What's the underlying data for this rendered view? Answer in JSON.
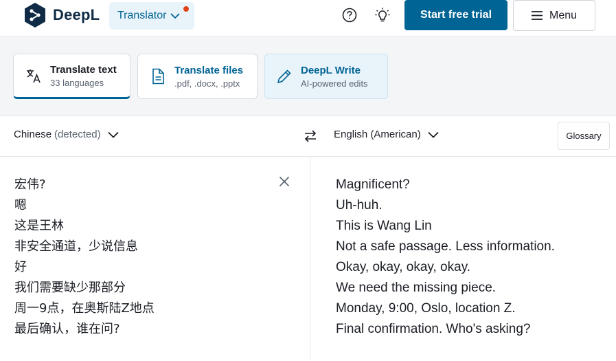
{
  "header": {
    "brand": "DeepL",
    "product_switch": "Translator",
    "start_trial": "Start free trial",
    "menu": "Menu",
    "colors": {
      "brand_dark": "#0f2b46",
      "primary": "#006494",
      "notification": "#e0431a"
    }
  },
  "tools": [
    {
      "title": "Translate text",
      "subtitle": "33 languages",
      "icon": "translate-icon",
      "active": true
    },
    {
      "title": "Translate files",
      "subtitle": ".pdf, .docx, .pptx",
      "icon": "document-icon",
      "active": false
    },
    {
      "title": "DeepL Write",
      "subtitle": "AI-powered edits",
      "icon": "pen-icon",
      "active": false
    }
  ],
  "languages": {
    "source": "Chinese",
    "source_note": "(detected)",
    "target": "English (American)",
    "glossary": "Glossary"
  },
  "source_lines": [
    "宏伟?",
    "嗯",
    "这是王林",
    "非安全通道，少说信息",
    "好",
    "我们需要缺少那部分",
    "周一9点，在奥斯陆Z地点",
    "最后确认，谁在问?"
  ],
  "target_lines": [
    "Magnificent?",
    "Uh-huh.",
    "This is Wang Lin",
    "Not a safe passage. Less information.",
    "Okay, okay, okay, okay.",
    "We need the missing piece.",
    "Monday, 9:00, Oslo, location Z.",
    "Final confirmation. Who's asking?"
  ]
}
